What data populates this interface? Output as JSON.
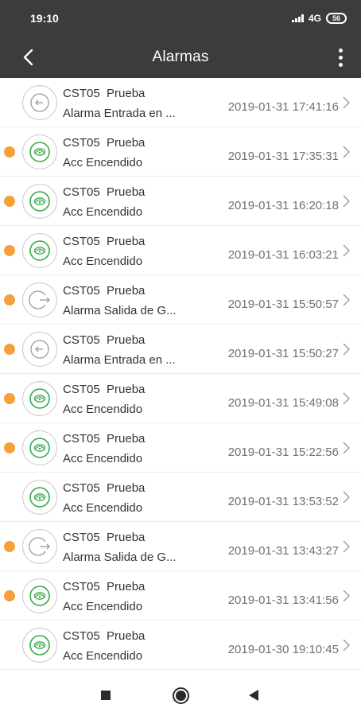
{
  "status_bar": {
    "time": "19:10",
    "network": "4G",
    "battery": "56"
  },
  "app_bar": {
    "title": "Alarmas",
    "back_icon": "chevron-left-icon",
    "menu_icon": "more-vertical-icon"
  },
  "colors": {
    "bar_background": "#3c3c3c",
    "unread_dot": "#f5a03c",
    "acc_icon_green": "#3aa84a"
  },
  "alarms": [
    {
      "unread": false,
      "icon": "geofence-enter-icon",
      "device": "CST05  Prueba",
      "type": "Alarma Entrada en ...",
      "datetime": "2019-01-31 17:41:16"
    },
    {
      "unread": true,
      "icon": "acc-icon",
      "device": "CST05  Prueba",
      "type": "Acc Encendido",
      "datetime": "2019-01-31 17:35:31"
    },
    {
      "unread": true,
      "icon": "acc-icon",
      "device": "CST05  Prueba",
      "type": "Acc Encendido",
      "datetime": "2019-01-31 16:20:18"
    },
    {
      "unread": true,
      "icon": "acc-icon",
      "device": "CST05  Prueba",
      "type": "Acc Encendido",
      "datetime": "2019-01-31 16:03:21"
    },
    {
      "unread": true,
      "icon": "geofence-exit-icon",
      "device": "CST05  Prueba",
      "type": "Alarma Salida de G...",
      "datetime": "2019-01-31 15:50:57"
    },
    {
      "unread": true,
      "icon": "geofence-enter-icon",
      "device": "CST05  Prueba",
      "type": "Alarma Entrada en ...",
      "datetime": "2019-01-31 15:50:27"
    },
    {
      "unread": true,
      "icon": "acc-icon",
      "device": "CST05  Prueba",
      "type": "Acc Encendido",
      "datetime": "2019-01-31 15:49:08"
    },
    {
      "unread": true,
      "icon": "acc-icon",
      "device": "CST05  Prueba",
      "type": "Acc Encendido",
      "datetime": "2019-01-31 15:22:56"
    },
    {
      "unread": false,
      "icon": "acc-icon",
      "device": "CST05  Prueba",
      "type": "Acc Encendido",
      "datetime": "2019-01-31 13:53:52"
    },
    {
      "unread": true,
      "icon": "geofence-exit-icon",
      "device": "CST05  Prueba",
      "type": "Alarma Salida de G...",
      "datetime": "2019-01-31 13:43:27"
    },
    {
      "unread": true,
      "icon": "acc-icon",
      "device": "CST05  Prueba",
      "type": "Acc Encendido",
      "datetime": "2019-01-31 13:41:56"
    },
    {
      "unread": false,
      "icon": "acc-icon",
      "device": "CST05  Prueba",
      "type": "Acc Encendido",
      "datetime": "2019-01-30 19:10:45"
    }
  ],
  "nav_bar": {
    "recents_icon": "square-icon",
    "home_icon": "circle-home-icon",
    "back_icon": "triangle-back-icon"
  }
}
